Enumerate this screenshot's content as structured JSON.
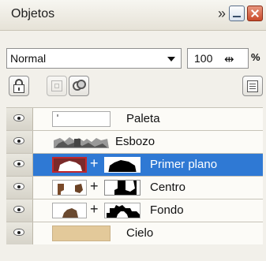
{
  "panel": {
    "title": "Objetos",
    "chevron": "»"
  },
  "controls": {
    "blend_mode": "Normal",
    "opacity": "100",
    "opacity_slider_glyph": "⇹",
    "opacity_unit": "%"
  },
  "layers": [
    {
      "name": "Paleta",
      "selected": false,
      "has_mask": false
    },
    {
      "name": "Esbozo",
      "selected": false,
      "has_mask": false
    },
    {
      "name": "Primer plano",
      "selected": true,
      "has_mask": true,
      "plus": "+"
    },
    {
      "name": "Centro",
      "selected": false,
      "has_mask": true,
      "plus": "+"
    },
    {
      "name": "Fondo",
      "selected": false,
      "has_mask": true,
      "plus": "+"
    },
    {
      "name": "Cielo",
      "selected": false,
      "has_mask": false
    }
  ],
  "colors": {
    "selection": "#2f79d4",
    "sky_swatch": "#e3c99a",
    "close_button": "#c94a2a"
  },
  "icons": [
    "lock-icon",
    "mask-icon",
    "overlap-icon",
    "properties-icon",
    "eye-icon"
  ]
}
